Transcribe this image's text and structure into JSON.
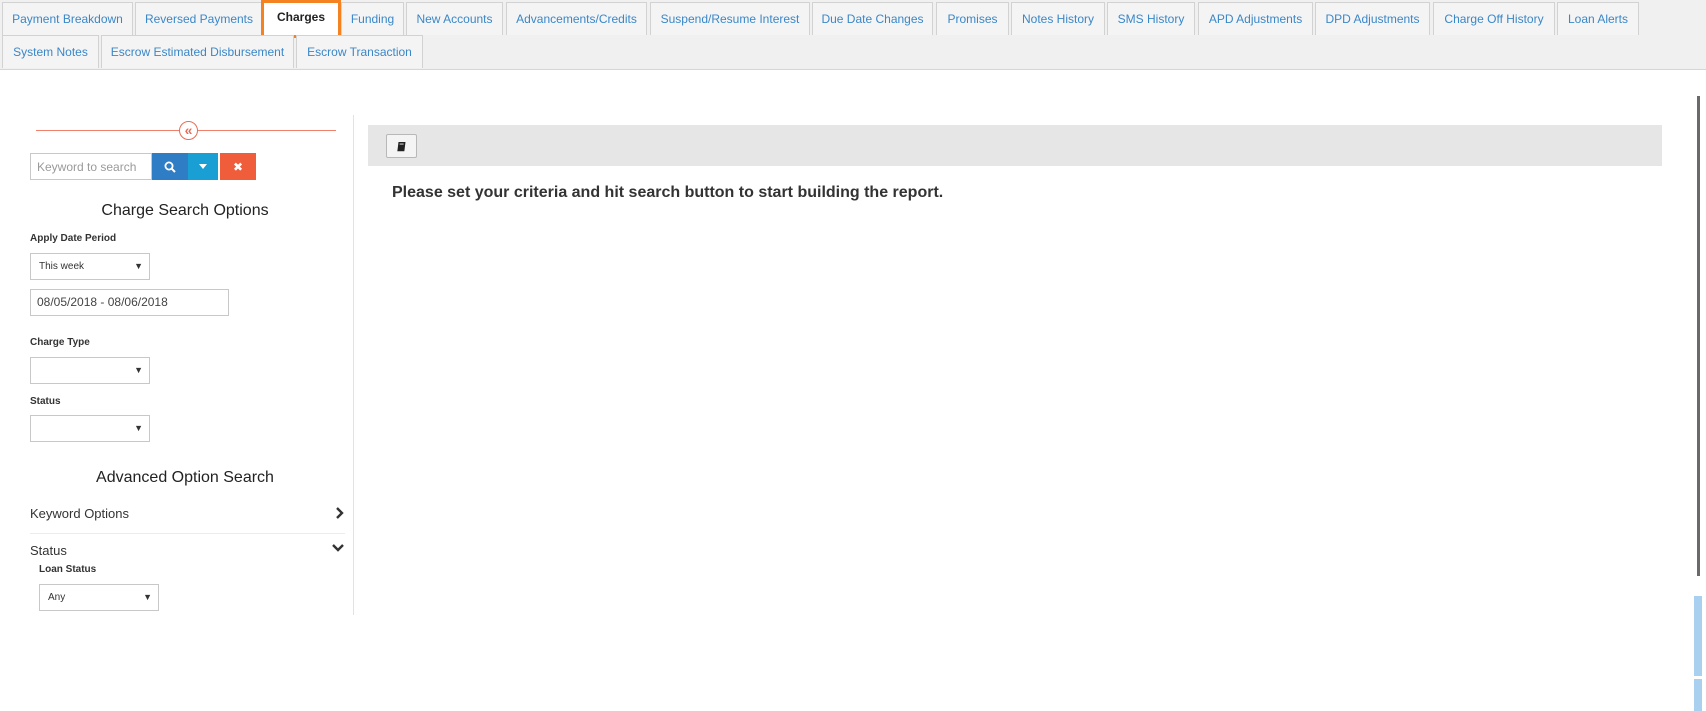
{
  "tabs": [
    {
      "label": "Payment Breakdown"
    },
    {
      "label": "Reversed Payments"
    },
    {
      "label": "Charges"
    },
    {
      "label": "Funding"
    },
    {
      "label": "New Accounts"
    },
    {
      "label": "Advancements/Credits"
    },
    {
      "label": "Suspend/Resume Interest"
    },
    {
      "label": "Due Date Changes"
    },
    {
      "label": "Promises"
    },
    {
      "label": "Notes History"
    },
    {
      "label": "SMS History"
    },
    {
      "label": "APD Adjustments"
    },
    {
      "label": "DPD Adjustments"
    },
    {
      "label": "Charge Off History"
    },
    {
      "label": "Loan Alerts"
    },
    {
      "label": "System Notes"
    },
    {
      "label": "Escrow Estimated Disbursement"
    },
    {
      "label": "Escrow Transaction"
    }
  ],
  "active_tab": "Charges",
  "sidebar": {
    "collapse_glyph": "«",
    "search": {
      "placeholder": "Keyword to search",
      "clear_glyph": "✖"
    },
    "search_options_title": "Charge Search Options",
    "apply_date_period": {
      "label": "Apply Date Period",
      "value": "This week"
    },
    "date_range": "08/05/2018 - 08/06/2018",
    "charge_type": {
      "label": "Charge Type",
      "value": ""
    },
    "status": {
      "label": "Status",
      "value": ""
    },
    "advanced_title": "Advanced Option Search",
    "keyword_options": "Keyword Options",
    "status_section": "Status",
    "loan_status": {
      "label": "Loan Status",
      "value": "Any"
    }
  },
  "main": {
    "message": "Please set your criteria and hit search button to start building the report."
  },
  "colors": {
    "tab_text": "#3a87c8",
    "active_outline": "#f58220",
    "search_button": "#2f7dc4",
    "dropdown_button": "#1a9fd4",
    "clear_button": "#ef5d3a"
  }
}
